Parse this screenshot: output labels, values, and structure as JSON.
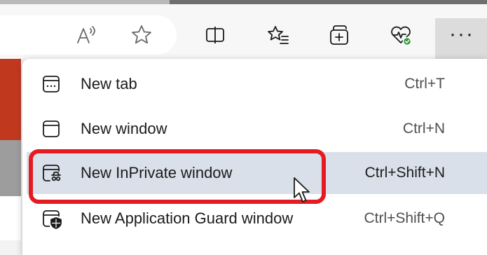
{
  "toolbar": {
    "icons": [
      {
        "name": "read-aloud-icon"
      },
      {
        "name": "favorite-star-icon"
      },
      {
        "name": "split-screen-icon"
      },
      {
        "name": "favorites-list-icon"
      },
      {
        "name": "collections-icon"
      },
      {
        "name": "browser-essentials-icon"
      }
    ],
    "more_label": "···"
  },
  "menu": {
    "items": [
      {
        "label": "New tab",
        "shortcut": "Ctrl+T",
        "icon": "new-tab-icon"
      },
      {
        "label": "New window",
        "shortcut": "Ctrl+N",
        "icon": "new-window-icon"
      },
      {
        "label": "New InPrivate window",
        "shortcut": "Ctrl+Shift+N",
        "icon": "inprivate-icon",
        "highlighted": true
      },
      {
        "label": "New Application Guard window",
        "shortcut": "Ctrl+Shift+Q",
        "icon": "application-guard-icon"
      }
    ]
  },
  "colors": {
    "highlight": "#d9e0e9",
    "callout_outline": "#e51b23",
    "health_badge": "#2e9b3a"
  }
}
